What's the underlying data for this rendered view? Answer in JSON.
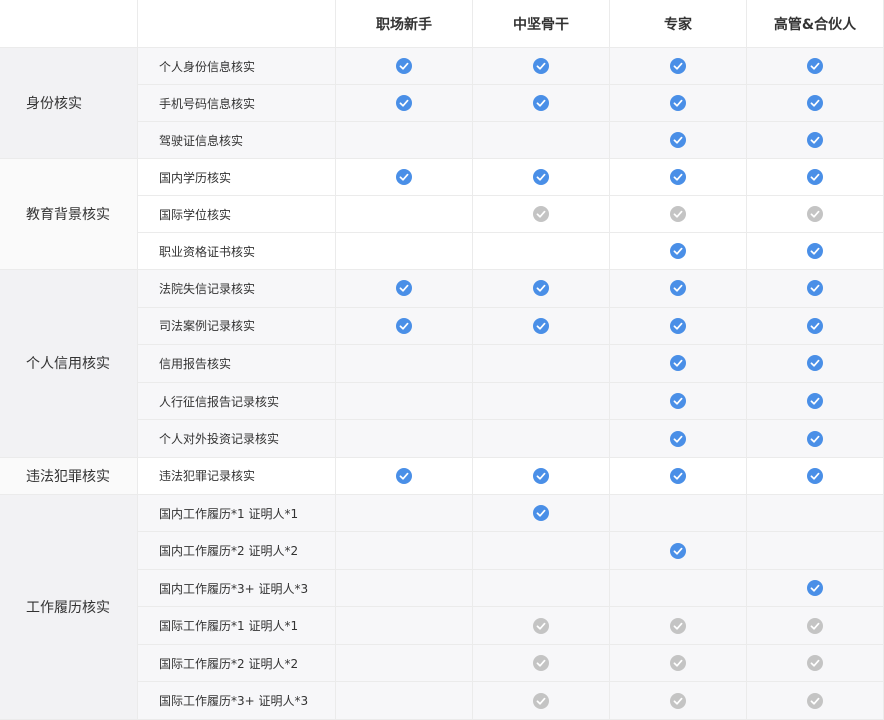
{
  "colors": {
    "check_included": "#4a8fe7",
    "check_optional": "#c4c4c4",
    "row_band": "#f7f7f9"
  },
  "table": {
    "corner_label": "",
    "header_blank": "",
    "plans": [
      "职场新手",
      "中坚骨干",
      "专家",
      "高管&合伙人"
    ],
    "groups": [
      {
        "category": "身份核实",
        "items": [
          {
            "name": "个人身份信息核实",
            "checks": [
              "blue",
              "blue",
              "blue",
              "blue"
            ]
          },
          {
            "name": "手机号码信息核实",
            "checks": [
              "blue",
              "blue",
              "blue",
              "blue"
            ]
          },
          {
            "name": "驾驶证信息核实",
            "checks": [
              "",
              "",
              "blue",
              "blue"
            ]
          }
        ]
      },
      {
        "category": "教育背景核实",
        "items": [
          {
            "name": "国内学历核实",
            "checks": [
              "blue",
              "blue",
              "blue",
              "blue"
            ]
          },
          {
            "name": "国际学位核实",
            "checks": [
              "",
              "gray",
              "gray",
              "gray"
            ]
          },
          {
            "name": "职业资格证书核实",
            "checks": [
              "",
              "",
              "blue",
              "blue"
            ]
          }
        ]
      },
      {
        "category": "个人信用核实",
        "items": [
          {
            "name": "法院失信记录核实",
            "checks": [
              "blue",
              "blue",
              "blue",
              "blue"
            ]
          },
          {
            "name": "司法案例记录核实",
            "checks": [
              "blue",
              "blue",
              "blue",
              "blue"
            ]
          },
          {
            "name": "信用报告核实",
            "checks": [
              "",
              "",
              "blue",
              "blue"
            ]
          },
          {
            "name": "人行征信报告记录核实",
            "checks": [
              "",
              "",
              "blue",
              "blue"
            ]
          },
          {
            "name": "个人对外投资记录核实",
            "checks": [
              "",
              "",
              "blue",
              "blue"
            ]
          }
        ]
      },
      {
        "category": "违法犯罪核实",
        "items": [
          {
            "name": "违法犯罪记录核实",
            "checks": [
              "blue",
              "blue",
              "blue",
              "blue"
            ]
          }
        ]
      },
      {
        "category": "工作履历核实",
        "items": [
          {
            "name": "国内工作履历*1 证明人*1",
            "checks": [
              "",
              "blue",
              "",
              ""
            ]
          },
          {
            "name": "国内工作履历*2 证明人*2",
            "checks": [
              "",
              "",
              "blue",
              ""
            ]
          },
          {
            "name": "国内工作履历*3+ 证明人*3",
            "checks": [
              "",
              "",
              "",
              "blue"
            ]
          },
          {
            "name": "国际工作履历*1 证明人*1",
            "checks": [
              "",
              "gray",
              "gray",
              "gray"
            ]
          },
          {
            "name": "国际工作履历*2 证明人*2",
            "checks": [
              "",
              "gray",
              "gray",
              "gray"
            ]
          },
          {
            "name": "国际工作履历*3+ 证明人*3",
            "checks": [
              "",
              "gray",
              "gray",
              "gray"
            ]
          }
        ]
      }
    ]
  }
}
